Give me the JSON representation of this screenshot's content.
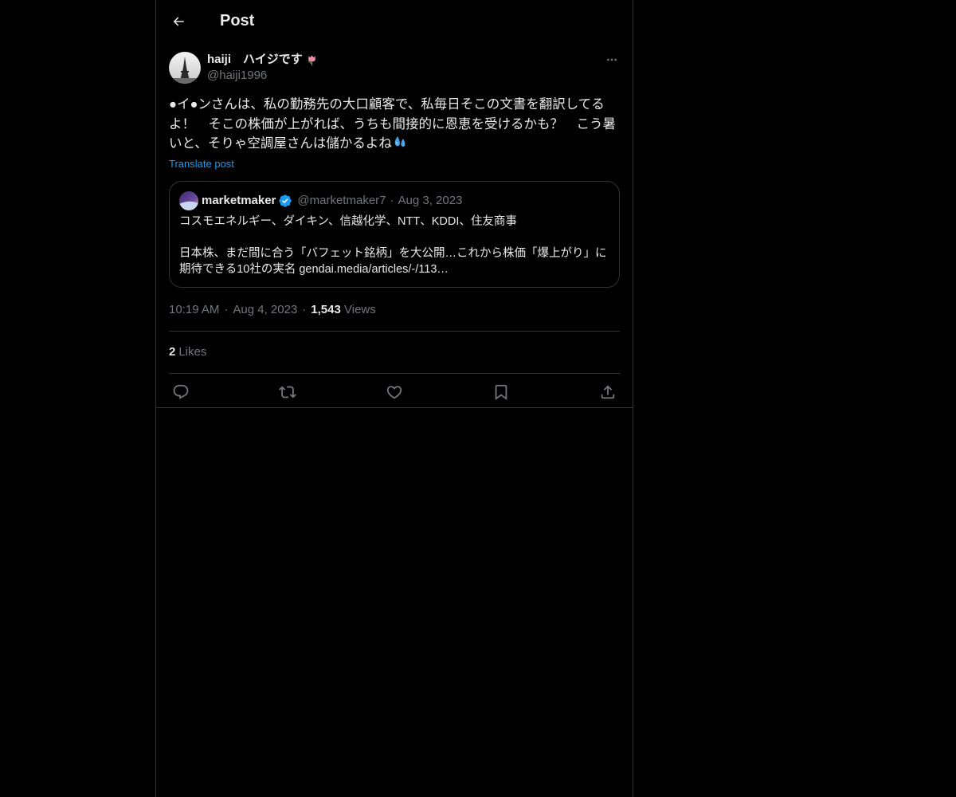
{
  "header": {
    "title": "Post"
  },
  "post": {
    "display_name": "haiji　ハイジです",
    "handle": "@haiji1996",
    "text": "●イ●ンさんは、私の勤務先の大口顧客で、私毎日そこの文書を翻訳してるよ！　そこの株価が上がれば、うちも間接的に恩恵を受けるかも？　こう暑いと、そりゃ空調屋さんは儲かるよね",
    "translate_label": "Translate post",
    "time": "10:19 AM",
    "date": "Aug 4, 2023",
    "views_count": "1,543",
    "views_label": "Views",
    "likes_count": "2",
    "likes_label": "Likes"
  },
  "quote": {
    "name": "marketmaker",
    "handle": "@marketmaker7",
    "date": "Aug 3, 2023",
    "text": "コスモエネルギー、ダイキン、信越化学、NTT、KDDI、住友商事\n\n日本株、まだ間に合う「バフェット銘柄」を大公開…これから株価「爆上がり」に期待できる10社の実名 gendai.media/articles/-/113…"
  },
  "colors": {
    "background": "#000000",
    "text": "#e7e9ea",
    "secondary": "#71767b",
    "accent": "#1d9bf0",
    "border": "#2f3336"
  },
  "icons": [
    "back-arrow-icon",
    "more-icon",
    "tulip-icon",
    "sweat-drops-icon",
    "verified-badge-icon",
    "reply-icon",
    "repost-icon",
    "like-icon",
    "bookmark-icon",
    "share-icon"
  ]
}
